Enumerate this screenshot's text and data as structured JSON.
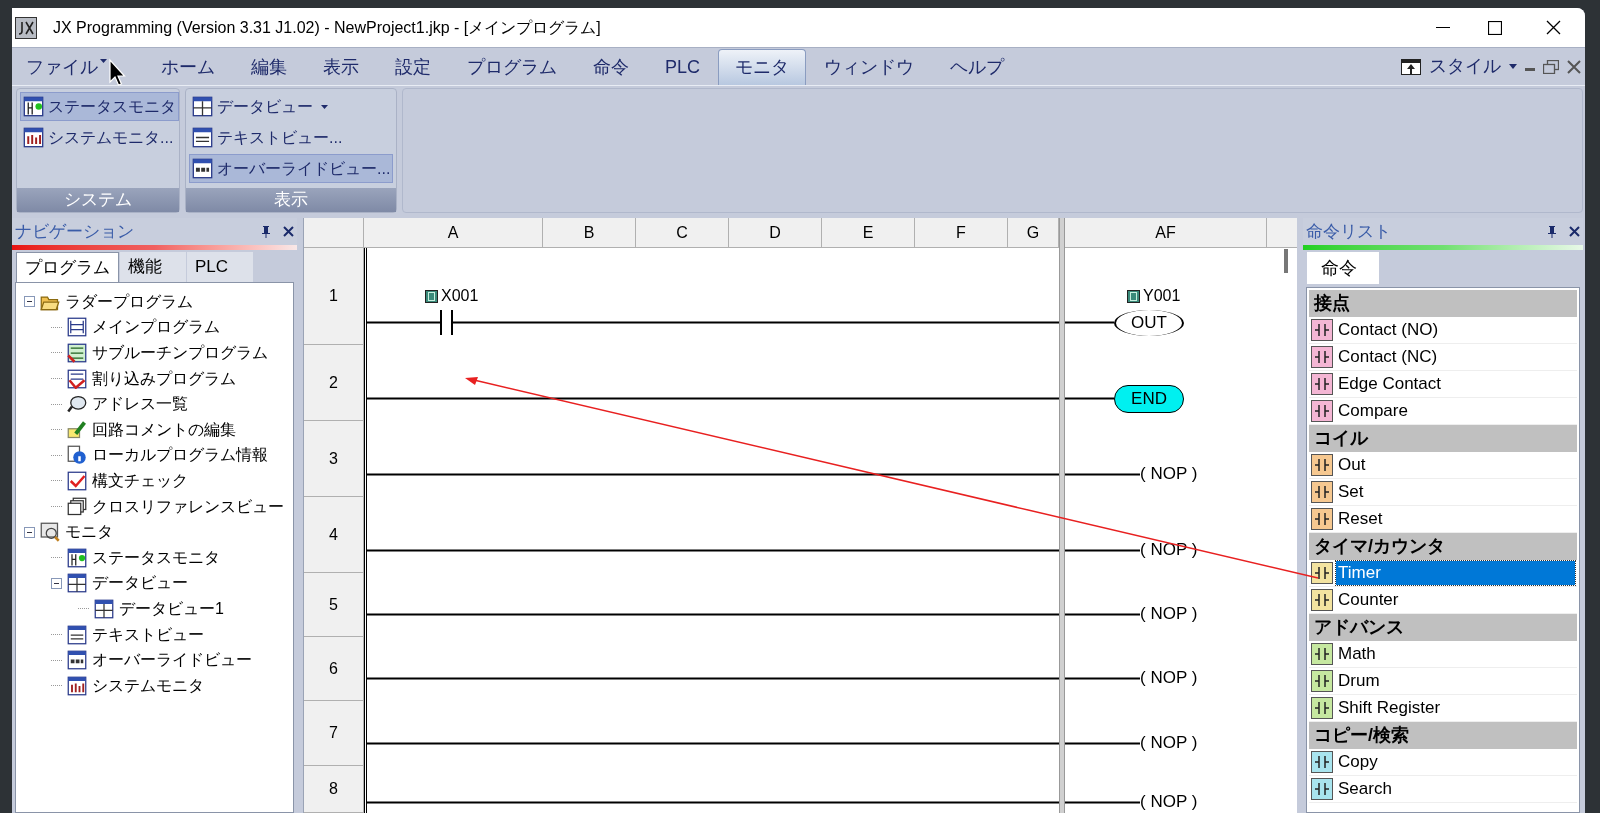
{
  "window": {
    "title": "JX Programming (Version 3.31 J1.02) - NewProject1.jkp - [メインプログラム]"
  },
  "menu_tabs": [
    {
      "label": "ファイル",
      "selected": false,
      "has_menu": true
    },
    {
      "label": "ホーム",
      "selected": false,
      "has_menu": false
    },
    {
      "label": "編集",
      "selected": false,
      "has_menu": false
    },
    {
      "label": "表示",
      "selected": false,
      "has_menu": false
    },
    {
      "label": "設定",
      "selected": false,
      "has_menu": false
    },
    {
      "label": "プログラム",
      "selected": false,
      "has_menu": false
    },
    {
      "label": "命令",
      "selected": false,
      "has_menu": false
    },
    {
      "label": "PLC",
      "selected": false,
      "has_menu": false
    },
    {
      "label": "モニタ",
      "selected": true,
      "has_menu": false
    },
    {
      "label": "ウィンドウ",
      "selected": false,
      "has_menu": false
    },
    {
      "label": "ヘルプ",
      "selected": false,
      "has_menu": false
    }
  ],
  "style_menu": {
    "label": "スタイル"
  },
  "ribbon_groups": [
    {
      "title": "システム",
      "items": [
        {
          "label": "ステータスモニタ",
          "kind": "status",
          "highlighted": true,
          "has_menu": false
        },
        {
          "label": "システムモニタ...",
          "kind": "system",
          "highlighted": false,
          "has_menu": false
        }
      ]
    },
    {
      "title": "表示",
      "items": [
        {
          "label": "データビュー",
          "kind": "data",
          "highlighted": false,
          "has_menu": true
        },
        {
          "label": "テキストビュー...",
          "kind": "text",
          "highlighted": false,
          "has_menu": false
        },
        {
          "label": "オーバーライドビュー...",
          "kind": "override",
          "highlighted": true,
          "has_menu": false
        }
      ]
    }
  ],
  "navigation": {
    "title": "ナビゲーション",
    "tabs": [
      {
        "label": "プログラム",
        "selected": true
      },
      {
        "label": "機能",
        "selected": false
      },
      {
        "label": "PLC",
        "selected": false
      }
    ],
    "tree": [
      {
        "label": "ラダープログラム",
        "kind": "folder",
        "expanded": true,
        "children": [
          {
            "label": "メインプログラム",
            "kind": "ladder"
          },
          {
            "label": "サブルーチンプログラム",
            "kind": "subroutine"
          },
          {
            "label": "割り込みプログラム",
            "kind": "interrupt"
          },
          {
            "label": "アドレス一覧",
            "kind": "address"
          },
          {
            "label": "回路コメントの編集",
            "kind": "comment"
          },
          {
            "label": "ローカルプログラム情報",
            "kind": "info"
          },
          {
            "label": "構文チェック",
            "kind": "check"
          },
          {
            "label": "クロスリファレンスビュー",
            "kind": "xref"
          }
        ]
      },
      {
        "label": "モニタ",
        "kind": "monitor",
        "expanded": true,
        "children": [
          {
            "label": "ステータスモニタ",
            "kind": "status"
          },
          {
            "label": "データビュー",
            "kind": "data",
            "expanded": true,
            "children": [
              {
                "label": "データビュー1",
                "kind": "data"
              }
            ]
          },
          {
            "label": "テキストビュー",
            "kind": "text"
          },
          {
            "label": "オーバーライドビュー",
            "kind": "override"
          },
          {
            "label": "システムモニタ",
            "kind": "system"
          }
        ]
      }
    ]
  },
  "ladder": {
    "columns": [
      "A",
      "B",
      "C",
      "D",
      "E",
      "F",
      "G",
      "AF"
    ],
    "rungs": [
      {
        "number": "1",
        "elements": [
          {
            "kind": "contact",
            "address": "X001"
          },
          {
            "kind": "coil",
            "instruction": "OUT",
            "address": "Y001"
          }
        ]
      },
      {
        "number": "2",
        "elements": [
          {
            "kind": "end",
            "instruction": "END"
          }
        ]
      },
      {
        "number": "3",
        "elements": [
          {
            "kind": "nop",
            "instruction": "( NOP )"
          }
        ]
      },
      {
        "number": "4",
        "elements": [
          {
            "kind": "nop",
            "instruction": "( NOP )"
          }
        ]
      },
      {
        "number": "5",
        "elements": [
          {
            "kind": "nop",
            "instruction": "( NOP )"
          }
        ]
      },
      {
        "number": "6",
        "elements": [
          {
            "kind": "nop",
            "instruction": "( NOP )"
          }
        ]
      },
      {
        "number": "7",
        "elements": [
          {
            "kind": "nop",
            "instruction": "( NOP )"
          }
        ]
      },
      {
        "number": "8",
        "elements": [
          {
            "kind": "nop",
            "instruction": "( NOP )"
          }
        ]
      }
    ]
  },
  "instruction_list": {
    "title": "命令リスト",
    "tabs": [
      {
        "label": "命令",
        "selected": true
      }
    ],
    "items": [
      {
        "kind": "header",
        "label": "接点",
        "selected": false
      },
      {
        "kind": "item",
        "label": "Contact (NO)",
        "color": "#f4b6d4",
        "selected": false
      },
      {
        "kind": "item",
        "label": "Contact (NC)",
        "color": "#f4b6d4",
        "selected": false
      },
      {
        "kind": "item",
        "label": "Edge Contact",
        "color": "#f4b6d4",
        "selected": false
      },
      {
        "kind": "item",
        "label": "Compare",
        "color": "#f4b6d4",
        "selected": false
      },
      {
        "kind": "header",
        "label": "コイル",
        "selected": false
      },
      {
        "kind": "item",
        "label": "Out",
        "color": "#f6c890",
        "selected": false
      },
      {
        "kind": "item",
        "label": "Set",
        "color": "#f6c890",
        "selected": false
      },
      {
        "kind": "item",
        "label": "Reset",
        "color": "#f6c890",
        "selected": false
      },
      {
        "kind": "header",
        "label": "タイマ/カウンタ",
        "selected": false
      },
      {
        "kind": "item",
        "label": "Timer",
        "color": "#f3e3a0",
        "selected": true
      },
      {
        "kind": "item",
        "label": "Counter",
        "color": "#f3e3a0",
        "selected": false
      },
      {
        "kind": "header",
        "label": "アドバンス",
        "selected": false
      },
      {
        "kind": "item",
        "label": "Math",
        "color": "#c6e8a0",
        "selected": false
      },
      {
        "kind": "item",
        "label": "Drum",
        "color": "#c6e8a0",
        "selected": false
      },
      {
        "kind": "item",
        "label": "Shift Register",
        "color": "#c6e8a0",
        "selected": false
      },
      {
        "kind": "header",
        "label": "コピー/検索",
        "selected": false
      },
      {
        "kind": "item",
        "label": "Copy",
        "color": "#a8e4ee",
        "selected": false
      },
      {
        "kind": "item",
        "label": "Search",
        "color": "#a8e4ee",
        "selected": false
      }
    ]
  }
}
